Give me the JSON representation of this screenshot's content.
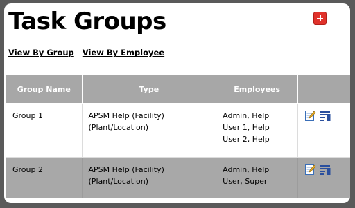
{
  "page": {
    "title": "Task Groups"
  },
  "links": {
    "by_group": "View By Group",
    "by_employee": "View By Employee"
  },
  "table": {
    "headers": [
      "Group Name",
      "Type",
      "Employees",
      ""
    ],
    "rows": [
      {
        "name": "Group 1",
        "type": "APSM Help (Facility) (Plant/Location)",
        "employees": [
          "Admin, Help",
          "User 1, Help",
          "User 2, Help"
        ]
      },
      {
        "name": "Group 2",
        "type": "APSM Help (Facility) (Plant/Location)",
        "employees": [
          "Admin, Help",
          "User, Super"
        ]
      }
    ]
  },
  "icons": {
    "add": "plus-icon",
    "edit": "edit-note-icon",
    "list": "list-sort-icon"
  },
  "colors": {
    "header_bg": "#a7a7a7",
    "add_button": "#e0322b",
    "frame": "#5a5a5a"
  }
}
